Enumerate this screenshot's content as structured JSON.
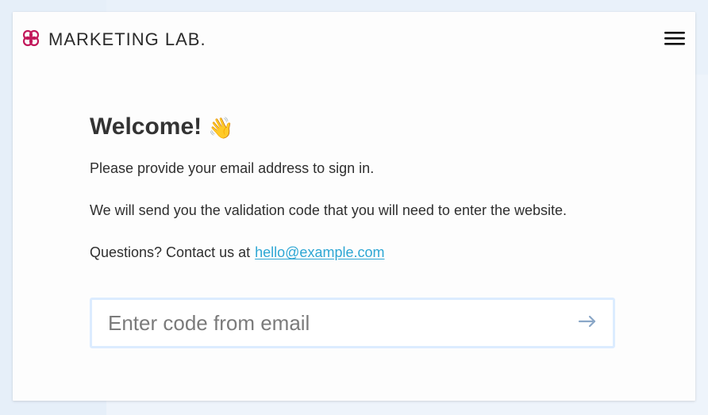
{
  "header": {
    "brand_name": "MARKETING LAB.",
    "brand_icon": "marketing-lab-logo-icon",
    "menu_icon": "hamburger-menu-icon",
    "accent_color": "#c2185b"
  },
  "main": {
    "title": "Welcome!",
    "title_emoji": "👋",
    "paragraphs": {
      "p1": "Please provide your email address to sign in.",
      "p2": "We will send you the validation code that you will need to enter the website.",
      "p3_prefix": "Questions? Contact us at",
      "p3_email": "hello@example.com"
    },
    "code_input": {
      "value": "",
      "placeholder": "Enter code from email",
      "submit_icon": "arrow-right-icon"
    }
  },
  "colors": {
    "link": "#2ea7d4",
    "input_border": "#dcecff",
    "text": "#2f2f2f"
  }
}
